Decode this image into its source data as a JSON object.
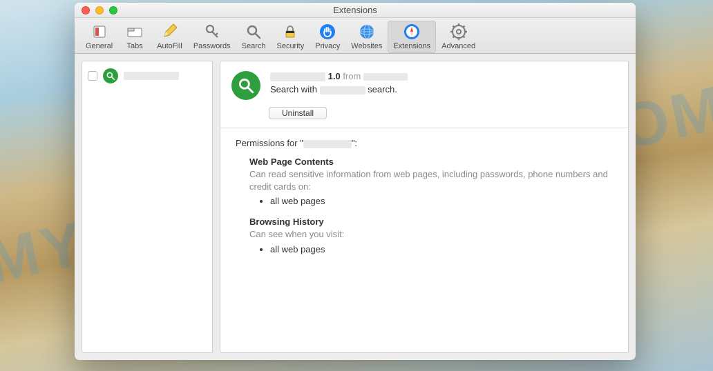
{
  "window": {
    "title": "Extensions"
  },
  "toolbar": {
    "items": [
      {
        "label": "General",
        "icon": "switch"
      },
      {
        "label": "Tabs",
        "icon": "tabs"
      },
      {
        "label": "AutoFill",
        "icon": "pencil"
      },
      {
        "label": "Passwords",
        "icon": "key"
      },
      {
        "label": "Search",
        "icon": "search"
      },
      {
        "label": "Security",
        "icon": "lock"
      },
      {
        "label": "Privacy",
        "icon": "hand"
      },
      {
        "label": "Websites",
        "icon": "globe"
      },
      {
        "label": "Extensions",
        "icon": "compass"
      },
      {
        "label": "Advanced",
        "icon": "gear"
      }
    ],
    "selected_index": 8
  },
  "sidebar": {
    "extension": {
      "name_redacted": true
    }
  },
  "detail": {
    "version": "1.0",
    "from_label": "from",
    "vendor_redacted": true,
    "desc_prefix": "Search with",
    "desc_mid_redacted": true,
    "desc_suffix": "search.",
    "uninstall_label": "Uninstall"
  },
  "permissions": {
    "title_prefix": "Permissions for \"",
    "title_name_redacted": true,
    "title_suffix": "\":",
    "sections": [
      {
        "title": "Web Page Contents",
        "desc": "Can read sensitive information from web pages, including passwords, phone numbers and credit cards on:",
        "items": [
          "all web pages"
        ]
      },
      {
        "title": "Browsing History",
        "desc": "Can see when you visit:",
        "items": [
          "all web pages"
        ]
      }
    ]
  },
  "watermark": "MYANTISPYWARE.COM"
}
